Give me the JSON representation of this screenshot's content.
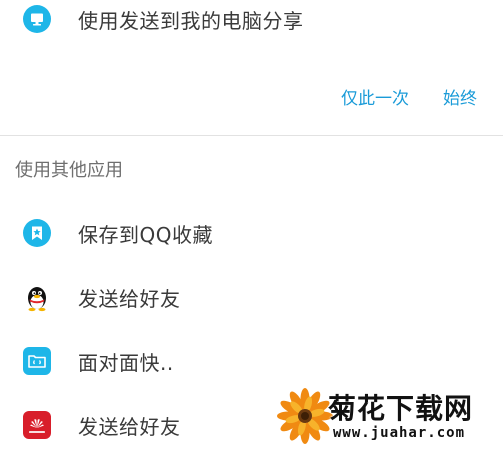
{
  "top_option": {
    "label": "使用发送到我的电脑分享",
    "icon": "computer-icon",
    "icon_color": "#1eb6e8"
  },
  "actions": {
    "once_label": "仅此一次",
    "always_label": "始终",
    "color": "#1a9bd8"
  },
  "other_apps": {
    "title": "使用其他应用",
    "items": [
      {
        "label": "保存到QQ收藏",
        "icon": "qq-favorites-icon",
        "icon_color": "#1eb6e8"
      },
      {
        "label": "发送给好友",
        "icon": "qq-penguin-icon"
      },
      {
        "label": "面对面快..",
        "icon": "face-to-face-transfer-icon",
        "icon_color": "#1eb6e8"
      },
      {
        "label": "发送给好友",
        "icon": "huawei-icon",
        "icon_color": "#d81e2a"
      }
    ]
  },
  "watermark": {
    "title": "菊花下载网",
    "url": "www.juahar.com"
  }
}
